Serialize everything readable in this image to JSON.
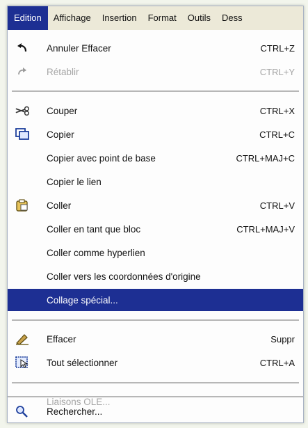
{
  "menubar": {
    "items": [
      "Edition",
      "Affichage",
      "Insertion",
      "Format",
      "Outils",
      "Dess"
    ]
  },
  "menu": {
    "items": [
      {
        "label": "Annuler Effacer",
        "shortcut": "CTRL+Z",
        "icon": "undo-icon"
      },
      {
        "label": "Rétablir",
        "shortcut": "CTRL+Y",
        "icon": "redo-icon",
        "disabled": true
      },
      {
        "label": "Couper",
        "shortcut": "CTRL+X",
        "icon": "scissors-icon"
      },
      {
        "label": "Copier",
        "shortcut": "CTRL+C",
        "icon": "copy-icon"
      },
      {
        "label": "Copier avec point de base",
        "shortcut": "CTRL+MAJ+C"
      },
      {
        "label": "Copier le lien",
        "shortcut": ""
      },
      {
        "label": "Coller",
        "shortcut": "CTRL+V",
        "icon": "paste-icon"
      },
      {
        "label": "Coller en tant que bloc",
        "shortcut": "CTRL+MAJ+V"
      },
      {
        "label": "Coller comme hyperlien",
        "shortcut": ""
      },
      {
        "label": "Coller vers les coordonnées d'origine",
        "shortcut": ""
      },
      {
        "label": "Collage spécial...",
        "shortcut": "",
        "highlighted": true
      },
      {
        "label": "Effacer",
        "shortcut": "Suppr",
        "icon": "eraser-icon"
      },
      {
        "label": "Tout sélectionner",
        "shortcut": "CTRL+A",
        "icon": "select-all-icon"
      },
      {
        "label": "Liaisons OLE...",
        "shortcut": "",
        "disabled": true
      },
      {
        "label": "Rechercher...",
        "shortcut": "",
        "icon": "search-icon"
      }
    ]
  },
  "colors": {
    "highlight": "#1d2f93",
    "menubar_bg": "#ece9d8",
    "disabled_text": "#a5a5a5"
  }
}
